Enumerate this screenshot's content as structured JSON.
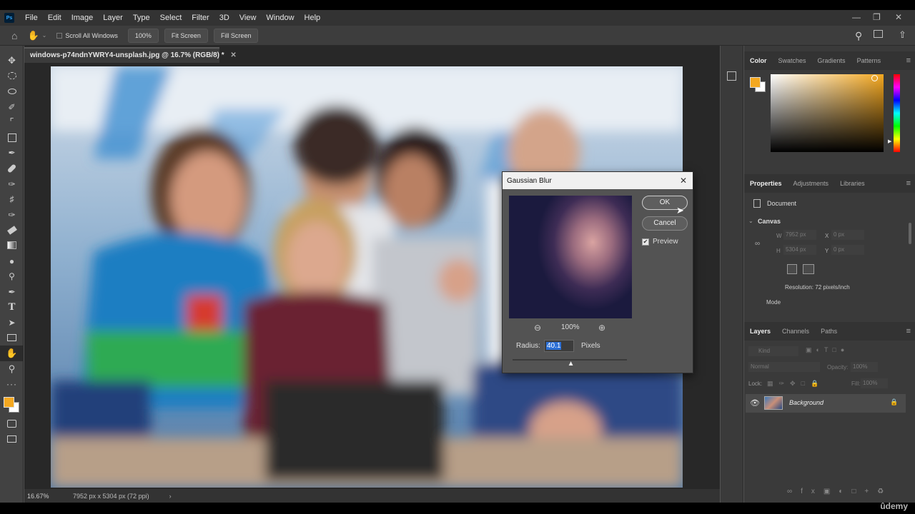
{
  "menubar": {
    "logo": "Ps",
    "items": [
      "File",
      "Edit",
      "Image",
      "Layer",
      "Type",
      "Select",
      "Filter",
      "3D",
      "View",
      "Window",
      "Help"
    ]
  },
  "options": {
    "scroll_all_windows": "Scroll All Windows",
    "zoom_100": "100%",
    "fit_screen": "Fit Screen",
    "fill_screen": "Fill Screen"
  },
  "document": {
    "tab_title": "windows-p74ndnYWRY4-unsplash.jpg @ 16.7% (RGB/8) *",
    "zoom_status": "16.67%",
    "size_status": "7952 px x 5304 px (72 ppi)"
  },
  "color_panel": {
    "tabs": [
      "Color",
      "Swatches",
      "Gradients",
      "Patterns"
    ],
    "fg_color": "#f4a820"
  },
  "properties_panel": {
    "tabs": [
      "Properties",
      "Adjustments",
      "Libraries"
    ],
    "doc_label": "Document",
    "canvas_label": "Canvas",
    "w_label": "W",
    "w_value": "7952 px",
    "h_label": "H",
    "h_value": "5304 px",
    "x_label": "X",
    "x_value": "0 px",
    "y_label": "Y",
    "y_value": "0 px",
    "resolution": "Resolution: 72 pixels/inch",
    "mode_label": "Mode"
  },
  "layers_panel": {
    "tabs": [
      "Layers",
      "Channels",
      "Paths"
    ],
    "kind_placeholder": "Kind",
    "blend_mode": "Normal",
    "opacity_label": "Opacity:",
    "opacity_value": "100%",
    "lock_label": "Lock:",
    "fill_label": "Fill:",
    "fill_value": "100%",
    "layer_name": "Background"
  },
  "dialog": {
    "title": "Gaussian Blur",
    "ok": "OK",
    "cancel": "Cancel",
    "preview_label": "Preview",
    "preview_checked": true,
    "zoom": "100%",
    "radius_label": "Radius:",
    "radius_value": "40.1",
    "unit": "Pixels",
    "slider_fraction": 0.51
  },
  "watermark": "ûdemy"
}
